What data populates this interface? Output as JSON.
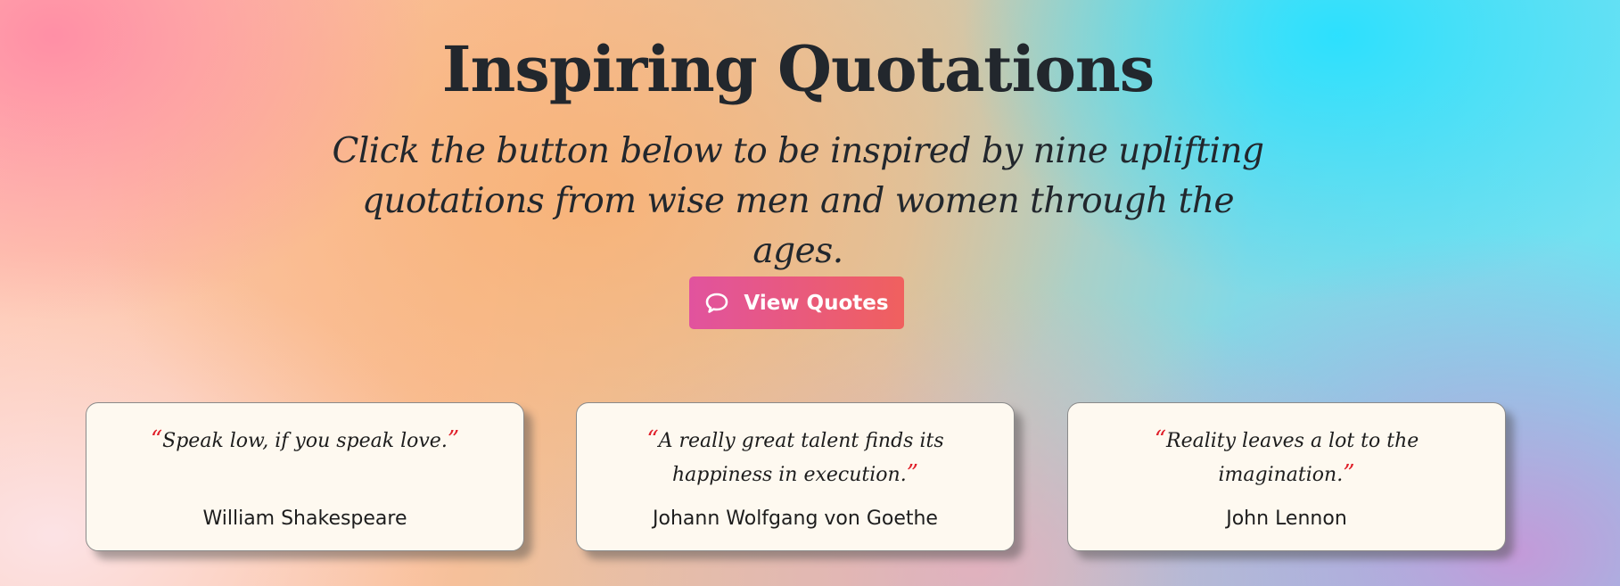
{
  "header": {
    "title": "Inspiring Quotations",
    "subtitle": "Click the button below to be inspired by nine uplifting quotations from wise men and women through the ages."
  },
  "button": {
    "label": "View Quotes",
    "icon": "speech-bubble-icon"
  },
  "quotes": [
    {
      "open_mark": "“",
      "text": "Speak low, if you speak love.",
      "close_mark": "”",
      "author": "William Shakespeare"
    },
    {
      "open_mark": "“",
      "text": "A really great talent finds its happiness in execution.",
      "close_mark": "”",
      "author": "Johann Wolfgang von Goethe"
    },
    {
      "open_mark": "“",
      "text": "Reality leaves a lot to the imagination.",
      "close_mark": "”",
      "author": "John Lennon"
    }
  ],
  "colors": {
    "button_gradient_start": "#e1539e",
    "button_gradient_end": "#f0605e",
    "quote_mark": "#e0202a",
    "card_background": "#fef9f0",
    "title_text": "#22272d"
  }
}
